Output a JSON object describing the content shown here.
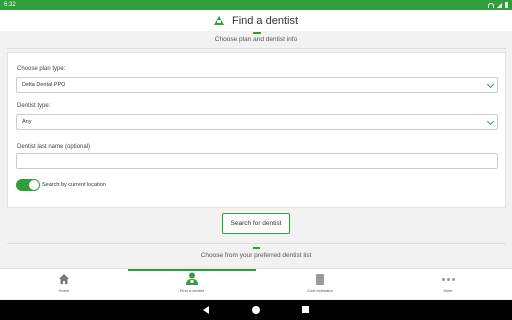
{
  "status_bar": {
    "time": "6:32"
  },
  "app_bar": {
    "title": "Find a dentist"
  },
  "step1": {
    "text": "Choose plan and dentist info"
  },
  "form": {
    "plan_type_label": "Choose plan type:",
    "plan_type_value": "Delta Dental PPO",
    "dentist_type_label": "Dentist type:",
    "dentist_type_value": "Any",
    "last_name_label": "Dentist last name (optional)",
    "last_name_value": "",
    "location_toggle_label": "Search by current location",
    "location_toggle_on": true
  },
  "search_button": {
    "label": "Search for dentist"
  },
  "step2": {
    "text": "Choose from your preferred dentist list"
  },
  "bottom_nav": {
    "tabs": [
      {
        "label": "Home",
        "icon": "home-icon"
      },
      {
        "label": "Find a dentist",
        "icon": "dentist-icon",
        "active": true
      },
      {
        "label": "Cost estimator",
        "icon": "calculator-icon"
      },
      {
        "label": "More",
        "icon": "more-dots-icon"
      }
    ]
  },
  "colors": {
    "accent": "#2f9e3b",
    "status_bar": "#2f9e3b"
  }
}
